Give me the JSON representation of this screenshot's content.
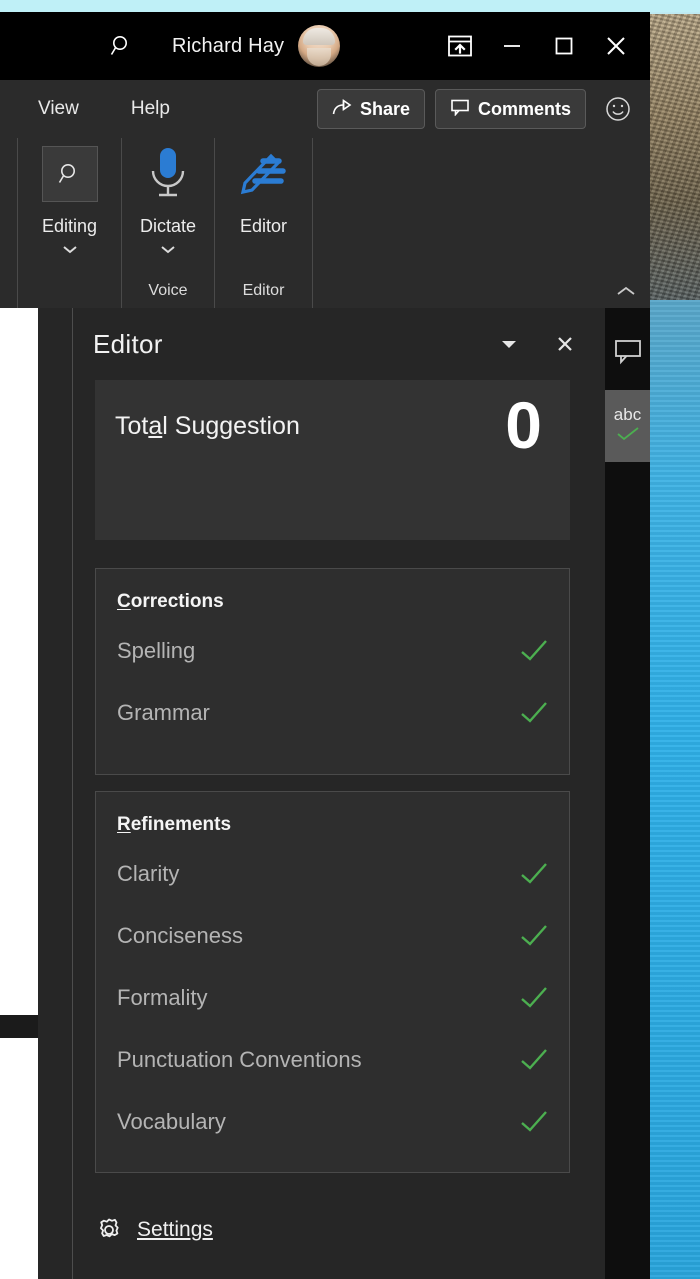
{
  "titlebar": {
    "search_icon": "search-icon",
    "user_name": "Richard Hay",
    "avatar_icon": "user-avatar",
    "ribbon_display_options_icon": "ribbon-display-options-icon",
    "minimize_icon": "minimize-icon",
    "maximize_icon": "maximize-icon",
    "close_icon": "close-icon"
  },
  "ribbon": {
    "tabs": [
      {
        "label": "View"
      },
      {
        "label": "Help"
      }
    ],
    "share_label": "Share",
    "share_icon": "share-icon",
    "comments_label": "Comments",
    "comments_icon": "comment-bubble-icon",
    "feedback_icon": "smiley-face-icon",
    "collapse_icon": "chevron-up-icon",
    "groups": [
      {
        "button_label": "Editing",
        "icon": "magnifier-icon",
        "has_dropdown": true,
        "group_name": ""
      },
      {
        "button_label": "Dictate",
        "icon": "microphone-icon",
        "has_dropdown": true,
        "group_name": "Voice"
      },
      {
        "button_label": "Editor",
        "icon": "editor-pen-icon",
        "has_dropdown": false,
        "group_name": "Editor"
      }
    ],
    "dialog_launcher_icon": "dialog-launcher-icon"
  },
  "pane": {
    "title": "Editor",
    "caret_icon": "chevron-down-icon",
    "close_icon": "close-icon",
    "total": {
      "label_prefix": "Tot",
      "label_accel": "a",
      "label_suffix": "l Suggestion",
      "label_full": "Total Suggestion",
      "value": "0"
    },
    "sections": [
      {
        "title_accel": "C",
        "title_rest": "orrections",
        "title_full": "Corrections",
        "items": [
          {
            "label": "Spelling",
            "status_icon": "green-check-icon"
          },
          {
            "label": "Grammar",
            "status_icon": "green-check-icon"
          }
        ]
      },
      {
        "title_accel": "R",
        "title_rest": "efinements",
        "title_full": "Refinements",
        "items": [
          {
            "label": "Clarity",
            "status_icon": "green-check-icon"
          },
          {
            "label": "Conciseness",
            "status_icon": "green-check-icon"
          },
          {
            "label": "Formality",
            "status_icon": "green-check-icon"
          },
          {
            "label": "Punctuation Conventions",
            "status_icon": "green-check-icon"
          },
          {
            "label": "Vocabulary",
            "status_icon": "green-check-icon"
          }
        ]
      }
    ],
    "settings": {
      "icon": "gear-icon",
      "label_accel": "S",
      "label_rest": "ettings",
      "label_full": "Settings"
    }
  },
  "rail": {
    "comments_icon": "comment-bubble-icon",
    "spelling_label": "abc",
    "spelling_icon": "spell-check-icon"
  },
  "colors": {
    "accent_green": "#4caf50",
    "pane_bg": "#262626",
    "card_bg": "#333333",
    "ribbon_bg": "#2b2b2b",
    "titlebar_bg": "#000000",
    "editor_icon_blue": "#2b7cd3"
  }
}
